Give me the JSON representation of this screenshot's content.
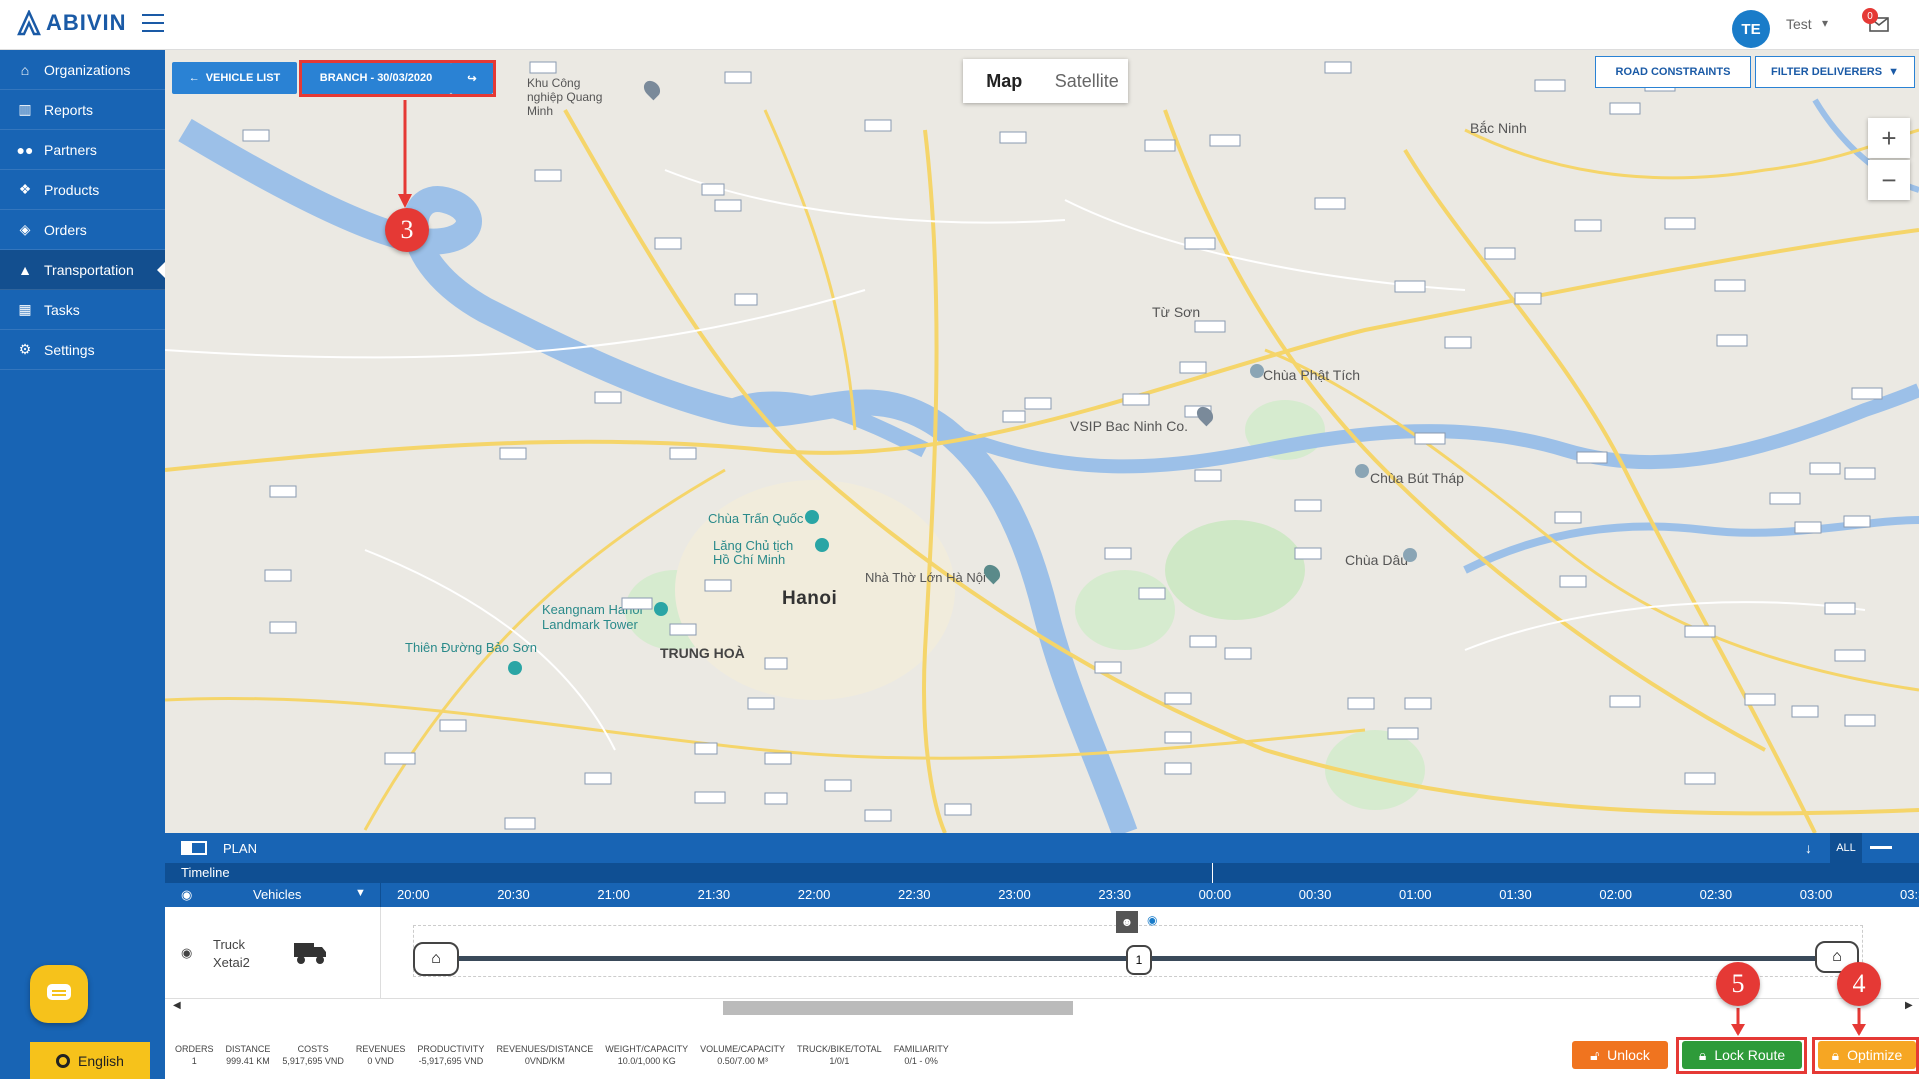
{
  "app": {
    "brand": "ABIVIN"
  },
  "user": {
    "initials": "TE",
    "name": "Test",
    "notifications": "0"
  },
  "sidebar": {
    "items": [
      {
        "label": "Organizations",
        "icon": "home-icon"
      },
      {
        "label": "Reports",
        "icon": "bar-chart-icon"
      },
      {
        "label": "Partners",
        "icon": "users-icon"
      },
      {
        "label": "Products",
        "icon": "dropbox-icon"
      },
      {
        "label": "Orders",
        "icon": "cubes-icon"
      },
      {
        "label": "Transportation",
        "icon": "road-icon",
        "active": true
      },
      {
        "label": "Tasks",
        "icon": "calendar-icon"
      },
      {
        "label": "Settings",
        "icon": "gear-icon"
      }
    ],
    "language": "English"
  },
  "map": {
    "vehicle_list": "VEHICLE LIST",
    "branch": "BRANCH - 30/03/2020",
    "map_tab": "Map",
    "satellite_tab": "Satellite",
    "road_constraints": "ROAD CONSTRAINTS",
    "filter_deliverers": "FILTER DELIVERERS",
    "zoom_in": "+",
    "zoom_out": "−",
    "city": "Hanoi",
    "places": [
      "Bắc Ninh",
      "Từ Sơn",
      "TRUNG HOÀ",
      "Chùa Dâu",
      "Chùa Phật Tích",
      "Chùa Bút Tháp",
      "VSIP Bac Ninh Co.",
      "Chùa Trấn Quốc",
      "Lăng Chủ tịch Hồ Chí Minh",
      "Nhà Thờ Lớn Hà Nội",
      "Keangnam Hanoi Landmark Tower",
      "Thiên Đường Bảo Sơn",
      "Khu Công nghiệp Quang Minh"
    ]
  },
  "callouts": [
    "3",
    "5",
    "4"
  ],
  "plan": {
    "title": "PLAN",
    "all_label": "ALL",
    "timeline_label": "Timeline",
    "vehicles_label": "Vehicles",
    "hours": [
      "20:00",
      "20:30",
      "21:00",
      "21:30",
      "22:00",
      "22:30",
      "23:00",
      "23:30",
      "00:00",
      "00:30",
      "01:00",
      "01:30",
      "02:00",
      "02:30",
      "03:00",
      "03:3"
    ],
    "vehicle": {
      "type": "Truck",
      "name": "Xetai2"
    },
    "stop_number": "1",
    "stats": [
      {
        "label": "ORDERS",
        "value": "1"
      },
      {
        "label": "DISTANCE",
        "value": "999.41 KM"
      },
      {
        "label": "COSTS",
        "value": "5,917,695 VND"
      },
      {
        "label": "REVENUES",
        "value": "0 VND"
      },
      {
        "label": "PRODUCTIVITY",
        "value": "-5,917,695 VND"
      },
      {
        "label": "REVENUES/DISTANCE",
        "value": "0VND/KM"
      },
      {
        "label": "WEIGHT/CAPACITY",
        "value": "10.0/1,000 KG"
      },
      {
        "label": "VOLUME/CAPACITY",
        "value": "0.50/7.00 M³"
      },
      {
        "label": "TRUCK/BIKE/TOTAL",
        "value": "1/0/1"
      },
      {
        "label": "FAMILIARITY",
        "value": "0/1 - 0%"
      }
    ],
    "unlock": "Unlock",
    "lock_route": "Lock Route",
    "optimize": "Optimize"
  },
  "colors": {
    "primary": "#1864b4",
    "accent": "#2a82d4",
    "callout": "#e53935",
    "optimize": "#f6a623",
    "lock": "#2e9b3a",
    "unlock": "#f0741f"
  }
}
